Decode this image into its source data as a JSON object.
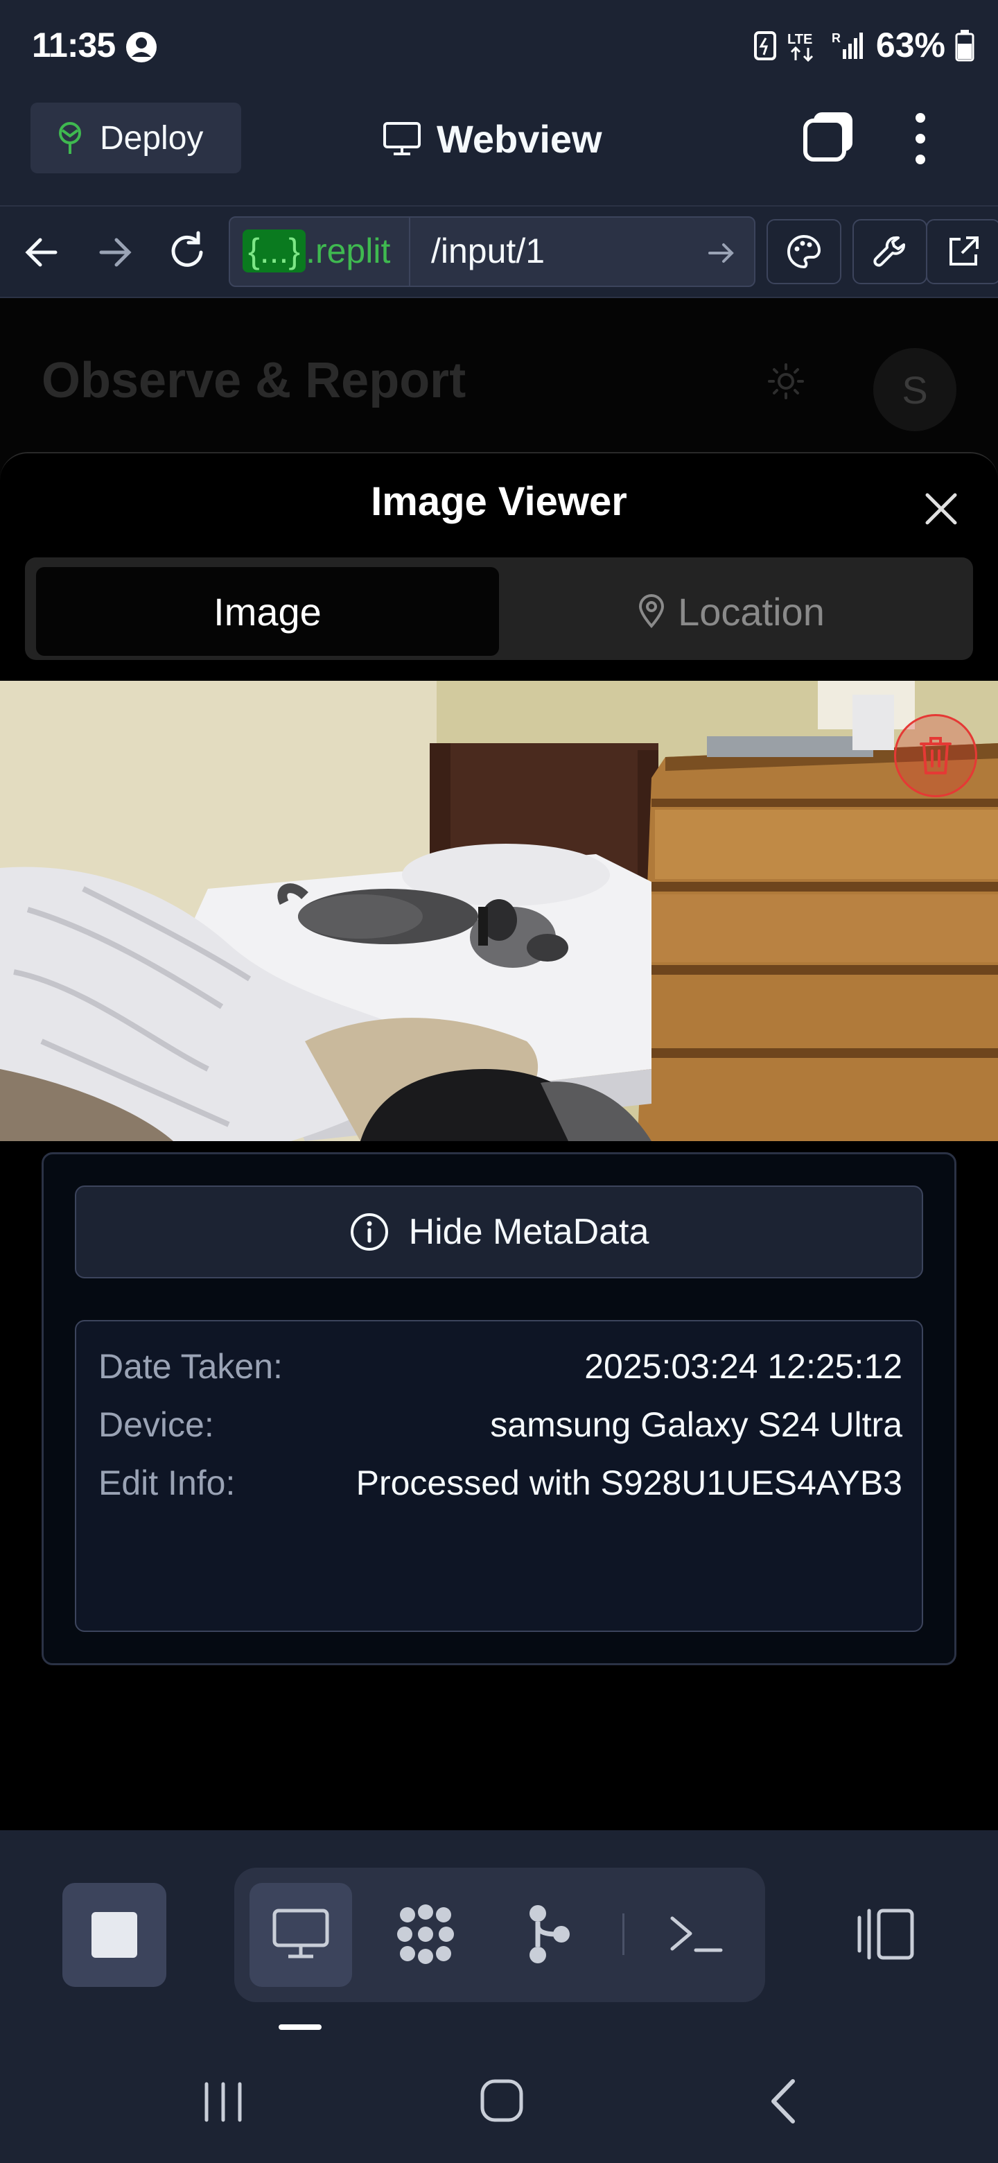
{
  "status_bar": {
    "time": "11:35",
    "battery": "63%"
  },
  "top_bar": {
    "deploy_label": "Deploy",
    "webview_label": "Webview"
  },
  "url_bar": {
    "host_brace": "{...}",
    "host_suffix": ".replit",
    "path": "/input/1"
  },
  "app": {
    "title": "Observe & Report",
    "avatar_initial": "S"
  },
  "modal": {
    "title": "Image Viewer",
    "tabs": [
      {
        "label": "Image",
        "active": true
      },
      {
        "label": "Location",
        "active": false
      }
    ],
    "hide_metadata_label": "Hide MetaData",
    "metadata": [
      {
        "key": "Date Taken:",
        "value": "2025:03:24 12:25:12"
      },
      {
        "key": "Device:",
        "value": "samsung Galaxy S24 Ultra"
      },
      {
        "key": "Edit Info:",
        "value": "Processed with S928U1UES4AYB3"
      }
    ]
  },
  "colors": {
    "accent_green": "#3fb950",
    "danger_red": "#e53935",
    "chrome_bg": "#1c2333"
  }
}
